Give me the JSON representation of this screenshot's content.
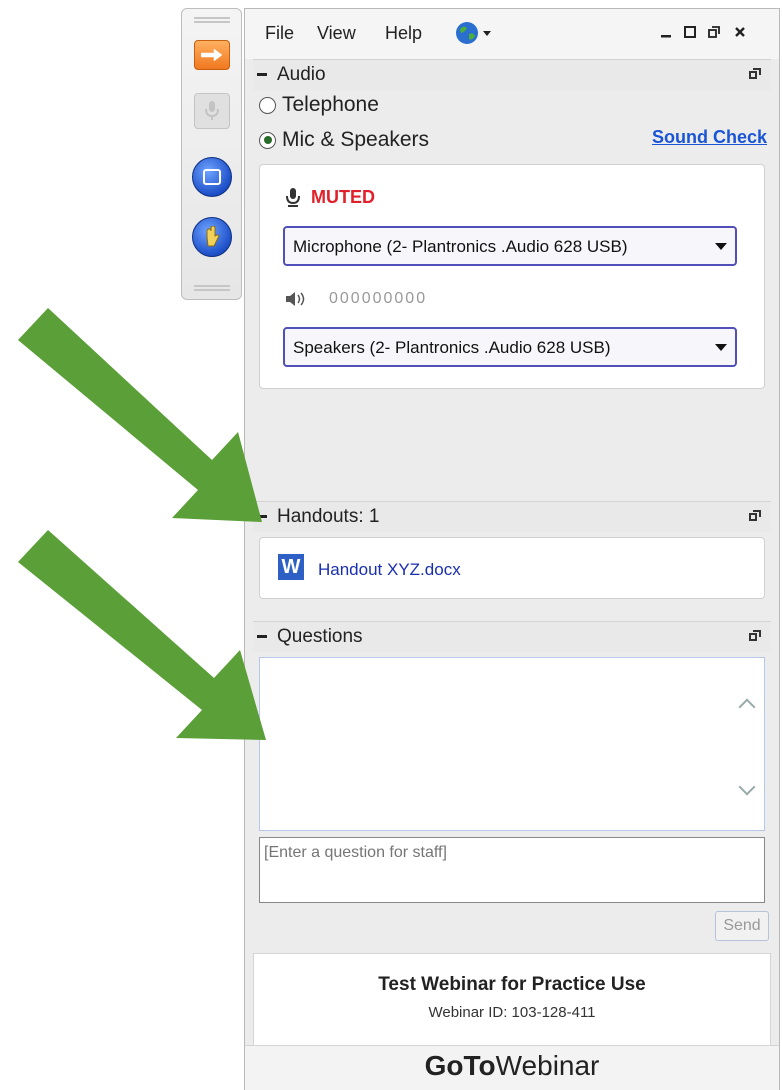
{
  "menu": {
    "file": "File",
    "view": "View",
    "help": "Help"
  },
  "audio": {
    "title": "Audio",
    "options": [
      "Telephone",
      "Mic & Speakers"
    ],
    "selected": "Mic & Speakers",
    "sound_check": "Sound Check",
    "mic_status": "MUTED",
    "microphone_value": "Microphone (2- Plantronics .Audio 628 USB)",
    "speaker_level": "000000000",
    "speakers_value": "Speakers (2- Plantronics .Audio 628 USB)"
  },
  "handouts": {
    "title": "Handouts: 1",
    "files": [
      {
        "icon": "W",
        "name": "Handout XYZ.docx"
      }
    ]
  },
  "questions": {
    "title": "Questions",
    "placeholder": "[Enter a question for staff]",
    "send": "Send"
  },
  "webinar": {
    "title": "Test Webinar for Practice Use",
    "id_text": "Webinar ID: 103-128-411",
    "brand_bold": "GoTo",
    "brand_rest": "Webinar"
  },
  "colors": {
    "accent_orange": "#f07820",
    "muted_red": "#e0202a",
    "arrow_green": "#5a9f37",
    "link_blue": "#1a55d6"
  }
}
